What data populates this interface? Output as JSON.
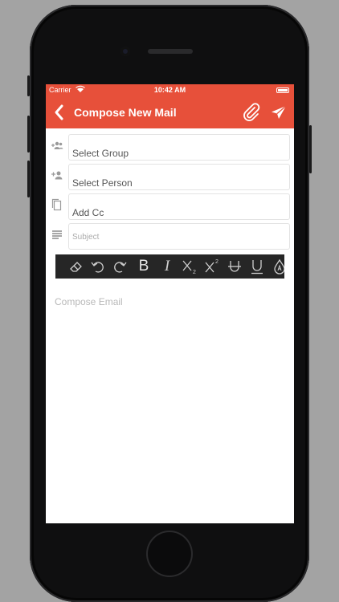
{
  "status_bar": {
    "carrier": "Carrier",
    "time": "10:42 AM"
  },
  "nav": {
    "title": "Compose New Mail"
  },
  "fields": {
    "group_placeholder": "Select Group",
    "person_placeholder": "Select Person",
    "cc_placeholder": "Add Cc",
    "subject_placeholder": "Subject"
  },
  "toolbar": {
    "bold": "B",
    "italic": "I"
  },
  "compose": {
    "placeholder": "Compose Email"
  },
  "colors": {
    "brand": "#e7503a",
    "toolbar_bg": "#262626"
  },
  "icons": [
    "chevron-left-icon",
    "paperclip-icon",
    "send-icon",
    "group-add-icon",
    "person-add-icon",
    "copy-icon",
    "subject-icon",
    "eraser-icon",
    "undo-icon",
    "redo-icon",
    "subscript-icon",
    "superscript-icon",
    "strikethrough-icon",
    "underline-icon",
    "text-color-icon"
  ]
}
